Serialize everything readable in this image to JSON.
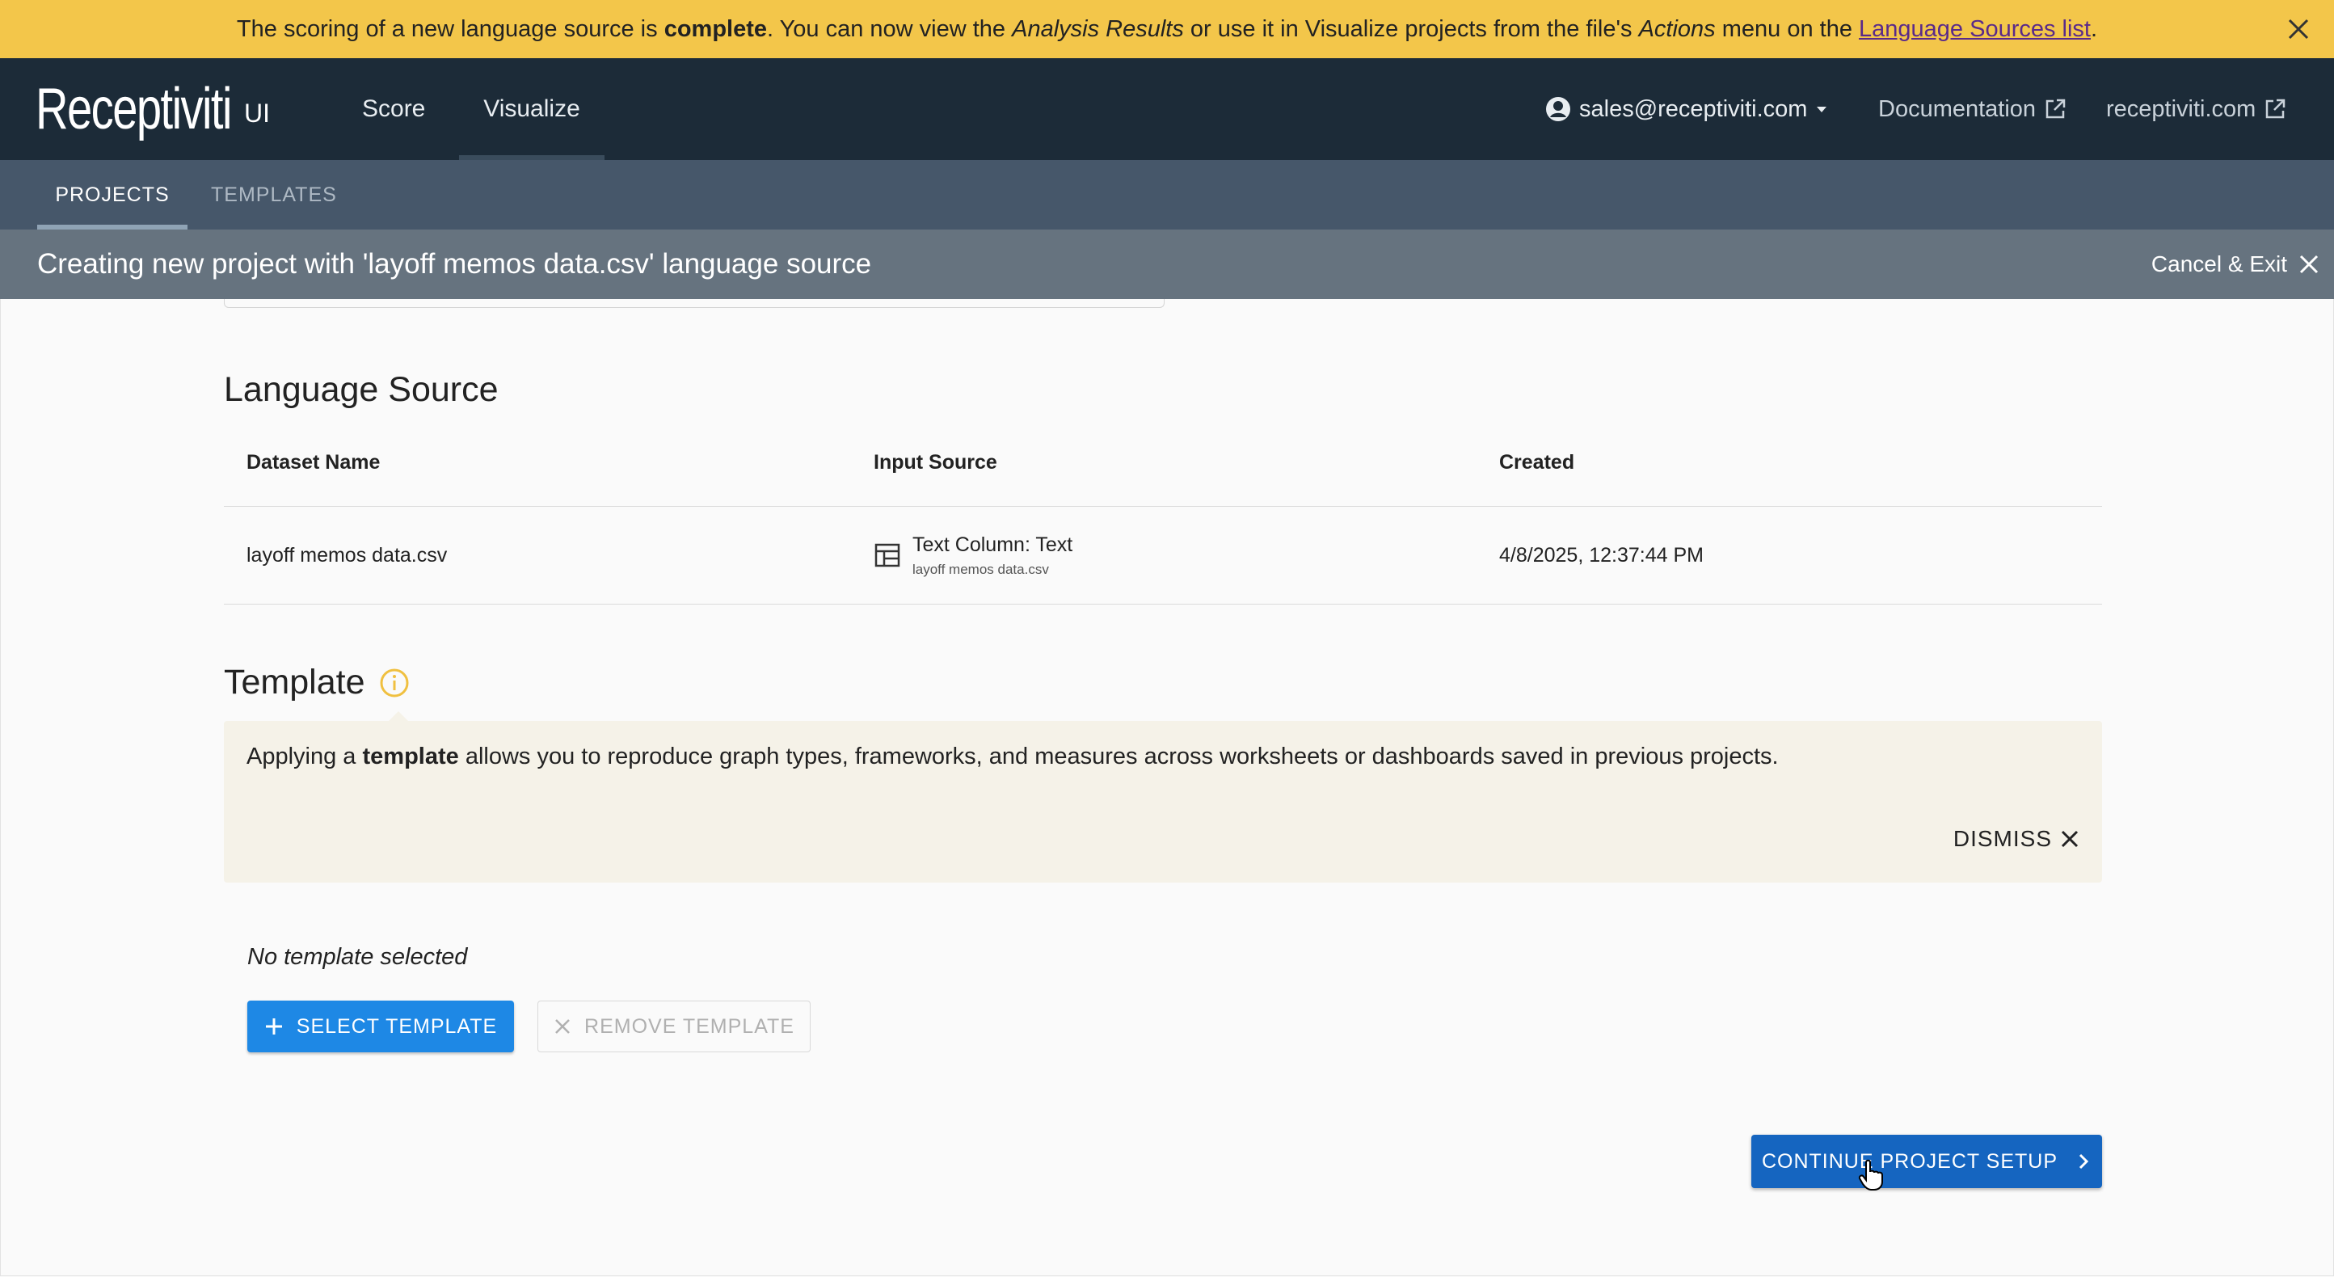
{
  "banner": {
    "text_1": "The scoring of a new language source is ",
    "text_bold": "complete",
    "text_2": ". You can now view the ",
    "text_italic_1": "Analysis Results",
    "text_3": " or use it in Visualize projects from the file's ",
    "text_italic_2": "Actions",
    "text_4": " menu on the ",
    "link": "Language Sources list",
    "text_5": ".",
    "close_icon": "close-icon"
  },
  "topnav": {
    "logo": "Receptiviti",
    "logo_suffix": "UI",
    "items": [
      {
        "label": "Score"
      },
      {
        "label": "Visualize",
        "active": true
      }
    ],
    "user": "sales@receptiviti.com",
    "docs": "Documentation",
    "site": "receptiviti.com"
  },
  "subnav": {
    "tabs": [
      {
        "label": "PROJECTS",
        "active": true
      },
      {
        "label": "TEMPLATES"
      }
    ]
  },
  "createbar": {
    "title": "Creating new project with 'layoff memos data.csv' language source",
    "cancel": "Cancel & Exit"
  },
  "language_source": {
    "title": "Language Source",
    "columns": [
      "Dataset Name",
      "Input Source",
      "Created"
    ],
    "rows": [
      {
        "dataset": "layoff memos data.csv",
        "input_main": "Text Column: Text",
        "input_sub": "layoff memos data.csv",
        "created": "4/8/2025, 12:37:44 PM"
      }
    ]
  },
  "template": {
    "title": "Template",
    "info_1": "Applying a ",
    "info_bold": "template",
    "info_2": " allows you to reproduce graph types, frameworks, and measures across worksheets or dashboards saved in previous projects.",
    "dismiss": "DISMISS",
    "none_selected": "No template selected",
    "select_btn": "SELECT TEMPLATE",
    "remove_btn": "REMOVE TEMPLATE"
  },
  "continue_btn": "CONTINUE PROJECT SETUP",
  "colors": {
    "banner": "#f3c64a",
    "topnav": "#1c2b38",
    "subnav": "#46576a",
    "createbar": "#66737f",
    "primary": "#1e88e5",
    "continue": "#1565c0",
    "info_bg": "#f5f2e8",
    "info_icon": "#f0c040"
  }
}
